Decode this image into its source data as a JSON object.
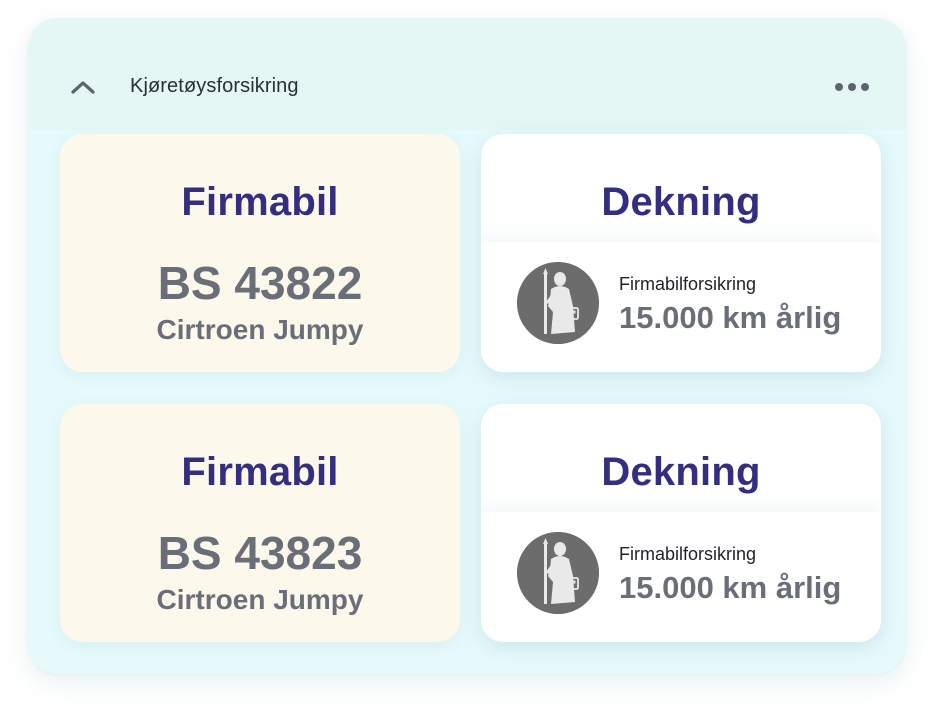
{
  "header": {
    "title": "Kjøretøysforsikring",
    "collapse_icon": "chevron-up-icon",
    "more_icon": "more-horizontal-icon"
  },
  "vehicles": [
    {
      "label": "Firmabil",
      "plate": "BS 43822",
      "model": "Cirtroen Jumpy",
      "coverage": {
        "title": "Dekning",
        "name": "Firmabilforsikring",
        "amount": "15.000 km årlig",
        "icon": "knight-shield-icon"
      }
    },
    {
      "label": "Firmabil",
      "plate": "BS 43823",
      "model": "Cirtroen Jumpy",
      "coverage": {
        "title": "Dekning",
        "name": "Firmabilforsikring",
        "amount": "15.000 km årlig",
        "icon": "knight-shield-icon"
      }
    }
  ],
  "colors": {
    "panel_bg": "#e6fafc",
    "header_bg": "#e5f7f4",
    "vehicle_card_bg": "#fdf8ec",
    "title_color": "#332e80",
    "value_color": "#6a6e78",
    "icon_bg": "#6c6c6c"
  }
}
